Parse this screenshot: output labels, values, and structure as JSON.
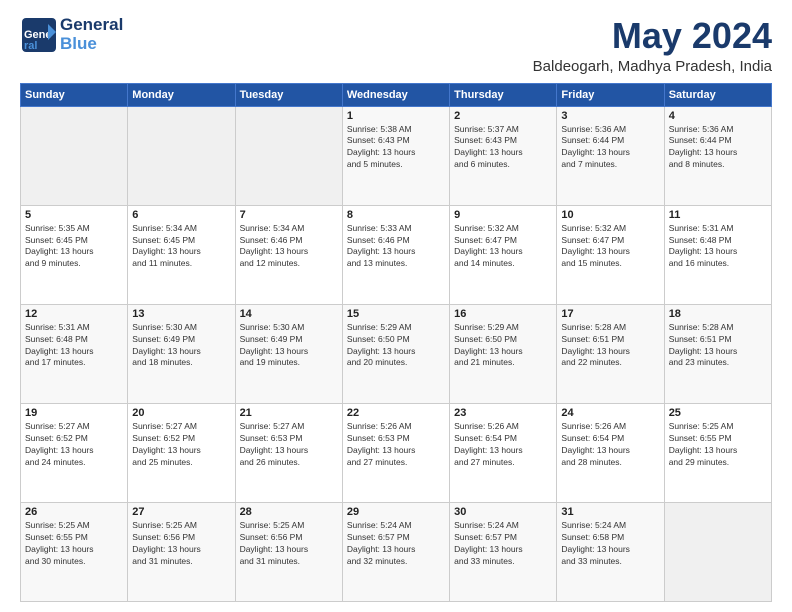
{
  "logo": {
    "line1": "General",
    "line2": "Blue"
  },
  "title": "May 2024",
  "subtitle": "Baldeogarh, Madhya Pradesh, India",
  "days_of_week": [
    "Sunday",
    "Monday",
    "Tuesday",
    "Wednesday",
    "Thursday",
    "Friday",
    "Saturday"
  ],
  "weeks": [
    [
      {
        "day": "",
        "info": ""
      },
      {
        "day": "",
        "info": ""
      },
      {
        "day": "",
        "info": ""
      },
      {
        "day": "1",
        "info": "Sunrise: 5:38 AM\nSunset: 6:43 PM\nDaylight: 13 hours\nand 5 minutes."
      },
      {
        "day": "2",
        "info": "Sunrise: 5:37 AM\nSunset: 6:43 PM\nDaylight: 13 hours\nand 6 minutes."
      },
      {
        "day": "3",
        "info": "Sunrise: 5:36 AM\nSunset: 6:44 PM\nDaylight: 13 hours\nand 7 minutes."
      },
      {
        "day": "4",
        "info": "Sunrise: 5:36 AM\nSunset: 6:44 PM\nDaylight: 13 hours\nand 8 minutes."
      }
    ],
    [
      {
        "day": "5",
        "info": "Sunrise: 5:35 AM\nSunset: 6:45 PM\nDaylight: 13 hours\nand 9 minutes."
      },
      {
        "day": "6",
        "info": "Sunrise: 5:34 AM\nSunset: 6:45 PM\nDaylight: 13 hours\nand 11 minutes."
      },
      {
        "day": "7",
        "info": "Sunrise: 5:34 AM\nSunset: 6:46 PM\nDaylight: 13 hours\nand 12 minutes."
      },
      {
        "day": "8",
        "info": "Sunrise: 5:33 AM\nSunset: 6:46 PM\nDaylight: 13 hours\nand 13 minutes."
      },
      {
        "day": "9",
        "info": "Sunrise: 5:32 AM\nSunset: 6:47 PM\nDaylight: 13 hours\nand 14 minutes."
      },
      {
        "day": "10",
        "info": "Sunrise: 5:32 AM\nSunset: 6:47 PM\nDaylight: 13 hours\nand 15 minutes."
      },
      {
        "day": "11",
        "info": "Sunrise: 5:31 AM\nSunset: 6:48 PM\nDaylight: 13 hours\nand 16 minutes."
      }
    ],
    [
      {
        "day": "12",
        "info": "Sunrise: 5:31 AM\nSunset: 6:48 PM\nDaylight: 13 hours\nand 17 minutes."
      },
      {
        "day": "13",
        "info": "Sunrise: 5:30 AM\nSunset: 6:49 PM\nDaylight: 13 hours\nand 18 minutes."
      },
      {
        "day": "14",
        "info": "Sunrise: 5:30 AM\nSunset: 6:49 PM\nDaylight: 13 hours\nand 19 minutes."
      },
      {
        "day": "15",
        "info": "Sunrise: 5:29 AM\nSunset: 6:50 PM\nDaylight: 13 hours\nand 20 minutes."
      },
      {
        "day": "16",
        "info": "Sunrise: 5:29 AM\nSunset: 6:50 PM\nDaylight: 13 hours\nand 21 minutes."
      },
      {
        "day": "17",
        "info": "Sunrise: 5:28 AM\nSunset: 6:51 PM\nDaylight: 13 hours\nand 22 minutes."
      },
      {
        "day": "18",
        "info": "Sunrise: 5:28 AM\nSunset: 6:51 PM\nDaylight: 13 hours\nand 23 minutes."
      }
    ],
    [
      {
        "day": "19",
        "info": "Sunrise: 5:27 AM\nSunset: 6:52 PM\nDaylight: 13 hours\nand 24 minutes."
      },
      {
        "day": "20",
        "info": "Sunrise: 5:27 AM\nSunset: 6:52 PM\nDaylight: 13 hours\nand 25 minutes."
      },
      {
        "day": "21",
        "info": "Sunrise: 5:27 AM\nSunset: 6:53 PM\nDaylight: 13 hours\nand 26 minutes."
      },
      {
        "day": "22",
        "info": "Sunrise: 5:26 AM\nSunset: 6:53 PM\nDaylight: 13 hours\nand 27 minutes."
      },
      {
        "day": "23",
        "info": "Sunrise: 5:26 AM\nSunset: 6:54 PM\nDaylight: 13 hours\nand 27 minutes."
      },
      {
        "day": "24",
        "info": "Sunrise: 5:26 AM\nSunset: 6:54 PM\nDaylight: 13 hours\nand 28 minutes."
      },
      {
        "day": "25",
        "info": "Sunrise: 5:25 AM\nSunset: 6:55 PM\nDaylight: 13 hours\nand 29 minutes."
      }
    ],
    [
      {
        "day": "26",
        "info": "Sunrise: 5:25 AM\nSunset: 6:55 PM\nDaylight: 13 hours\nand 30 minutes."
      },
      {
        "day": "27",
        "info": "Sunrise: 5:25 AM\nSunset: 6:56 PM\nDaylight: 13 hours\nand 31 minutes."
      },
      {
        "day": "28",
        "info": "Sunrise: 5:25 AM\nSunset: 6:56 PM\nDaylight: 13 hours\nand 31 minutes."
      },
      {
        "day": "29",
        "info": "Sunrise: 5:24 AM\nSunset: 6:57 PM\nDaylight: 13 hours\nand 32 minutes."
      },
      {
        "day": "30",
        "info": "Sunrise: 5:24 AM\nSunset: 6:57 PM\nDaylight: 13 hours\nand 33 minutes."
      },
      {
        "day": "31",
        "info": "Sunrise: 5:24 AM\nSunset: 6:58 PM\nDaylight: 13 hours\nand 33 minutes."
      },
      {
        "day": "",
        "info": ""
      }
    ]
  ]
}
